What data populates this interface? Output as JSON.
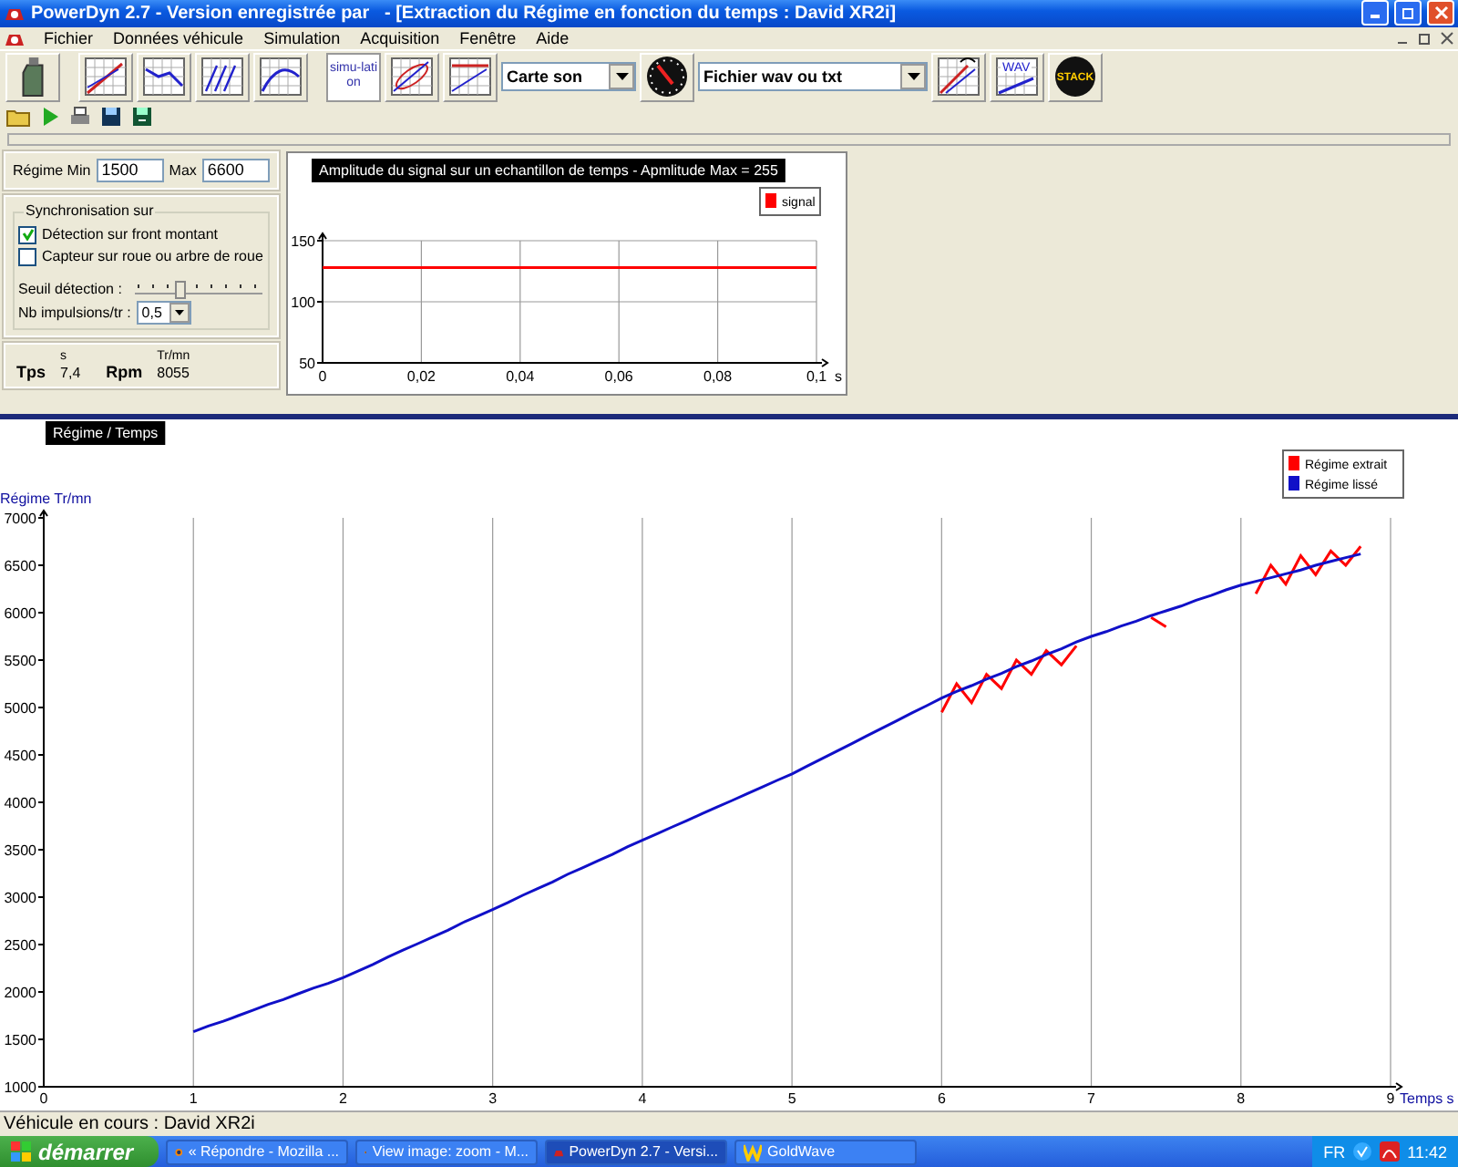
{
  "window": {
    "title": "PowerDyn 2.7 - Version enregistrée par   - [Extraction du Régime en fonction du temps : David XR2i]"
  },
  "menu": [
    "Fichier",
    "Données véhicule",
    "Simulation",
    "Acquisition",
    "Fenêtre",
    "Aide"
  ],
  "toolbar": {
    "simulation_label": "simu-lation",
    "sound_source": "Carte son",
    "file_source": "Fichier wav ou txt",
    "wav_label": "WAV",
    "stack_label": "STACK"
  },
  "regime": {
    "min_label": "Régime Min",
    "min": "1500",
    "max_label": "Max",
    "max": "6600"
  },
  "sync": {
    "title": "Synchronisation sur",
    "options": [
      {
        "label": "Détection sur front montant",
        "checked": true
      },
      {
        "label": "Capteur sur roue ou arbre de roue",
        "checked": false
      }
    ]
  },
  "threshold": {
    "label": "Seuil détection :",
    "level": 0.34
  },
  "pulses": {
    "label": "Nb impulsions/tr :",
    "value": "0,5"
  },
  "readout": [
    {
      "label": "Tps",
      "unit": "s",
      "value": "7,4"
    },
    {
      "label": "Rpm",
      "unit": "Tr/mn",
      "value": "8055"
    }
  ],
  "signal_chart": {
    "chart_data": {
      "type": "line",
      "title": "Amplitude du signal sur un echantillon de temps - Apmlitude Max = 255",
      "xlabel": "s",
      "x": [
        0,
        0.1
      ],
      "series": [
        {
          "name": "signal",
          "color": "#ff0000",
          "values": [
            128,
            128
          ]
        }
      ],
      "grid": "both",
      "legend": "upper right",
      "xlim": [
        0,
        0.1
      ],
      "ylim": [
        50,
        150
      ],
      "xticks": [
        0,
        {
          "value": 0.02,
          "label": "0,02"
        },
        {
          "value": 0.04,
          "label": "0,04"
        },
        {
          "value": 0.06,
          "label": "0,06"
        },
        {
          "value": 0.08,
          "label": "0,08"
        },
        {
          "value": 0.1,
          "label": "0,1"
        }
      ],
      "yticks": [
        50,
        100,
        150
      ]
    }
  },
  "main_chart": {
    "chart_data": {
      "type": "line",
      "title": "Régime / Temps",
      "xlabel": "Temps s",
      "ylabel": "Régime Tr/mn",
      "x": [
        1.0,
        1.1,
        1.2,
        1.3,
        1.4,
        1.5,
        1.6,
        1.7,
        1.8,
        1.9,
        2.0,
        2.1,
        2.2,
        2.3,
        2.4,
        2.5,
        2.6,
        2.7,
        2.8,
        2.9,
        3.0,
        3.1,
        3.2,
        3.3,
        3.4,
        3.5,
        3.6,
        3.7,
        3.8,
        3.9,
        4.0,
        4.1,
        4.2,
        4.3,
        4.4,
        4.5,
        4.6,
        4.7,
        4.8,
        4.9,
        5.0,
        5.1,
        5.2,
        5.3,
        5.4,
        5.5,
        5.6,
        5.7,
        5.8,
        5.9,
        6.0,
        6.1,
        6.2,
        6.3,
        6.4,
        6.5,
        6.6,
        6.7,
        6.8,
        6.9,
        7.0,
        7.1,
        7.2,
        7.3,
        7.4,
        7.5,
        7.6,
        7.7,
        7.8,
        7.9,
        8.0,
        8.1,
        8.2,
        8.3,
        8.4,
        8.5,
        8.6,
        8.7,
        8.8
      ],
      "series": [
        {
          "name": "Régime extrait",
          "color": "#ff0000",
          "values": [
            null,
            null,
            null,
            null,
            null,
            null,
            null,
            null,
            null,
            null,
            null,
            null,
            null,
            null,
            null,
            null,
            null,
            null,
            null,
            null,
            null,
            null,
            null,
            null,
            null,
            null,
            null,
            null,
            null,
            null,
            null,
            null,
            null,
            null,
            null,
            null,
            null,
            null,
            null,
            null,
            null,
            null,
            null,
            null,
            null,
            null,
            null,
            null,
            null,
            null,
            4950,
            5250,
            5050,
            5350,
            5200,
            5500,
            5350,
            5600,
            5450,
            5650,
            null,
            null,
            null,
            null,
            5950,
            5850,
            null,
            null,
            null,
            null,
            null,
            6200,
            6500,
            6300,
            6600,
            6400,
            6650,
            6500,
            6700
          ]
        },
        {
          "name": "Régime lissé",
          "color": "#1010c8",
          "values": [
            1580,
            1640,
            1690,
            1750,
            1810,
            1870,
            1920,
            1980,
            2040,
            2090,
            2150,
            2220,
            2290,
            2370,
            2440,
            2510,
            2580,
            2650,
            2730,
            2800,
            2870,
            2940,
            3020,
            3090,
            3160,
            3240,
            3310,
            3380,
            3450,
            3530,
            3600,
            3670,
            3740,
            3810,
            3880,
            3950,
            4020,
            4090,
            4160,
            4230,
            4300,
            4380,
            4460,
            4540,
            4620,
            4700,
            4780,
            4860,
            4940,
            5020,
            5100,
            5170,
            5230,
            5300,
            5360,
            5430,
            5490,
            5560,
            5620,
            5690,
            5750,
            5800,
            5860,
            5910,
            5970,
            6020,
            6070,
            6130,
            6180,
            6240,
            6290,
            6330,
            6370,
            6410,
            6450,
            6500,
            6540,
            6580,
            6620
          ]
        }
      ],
      "grid": "x",
      "legend": "upper right",
      "xlim": [
        0,
        9
      ],
      "ylim": [
        1000,
        7000
      ],
      "xticks": [
        0,
        1,
        2,
        3,
        4,
        5,
        6,
        7,
        8,
        9
      ],
      "yticks": [
        1000,
        1500,
        2000,
        2500,
        3000,
        3500,
        4000,
        4500,
        5000,
        5500,
        6000,
        6500,
        7000
      ]
    }
  },
  "status_bar": "Véhicule en cours : David XR2i",
  "taskbar": {
    "start": "démarrer",
    "tasks": [
      {
        "kind": "browser",
        "label": "« Répondre - Mozilla ...",
        "selected": false
      },
      {
        "kind": "browser",
        "label": "View image: zoom - M...",
        "selected": false
      },
      {
        "kind": "powerdyn",
        "label": "PowerDyn 2.7 - Versi...",
        "selected": true
      },
      {
        "kind": "goldwave",
        "label": "GoldWave",
        "selected": false
      }
    ],
    "language": "FR",
    "clock": "11:42"
  }
}
